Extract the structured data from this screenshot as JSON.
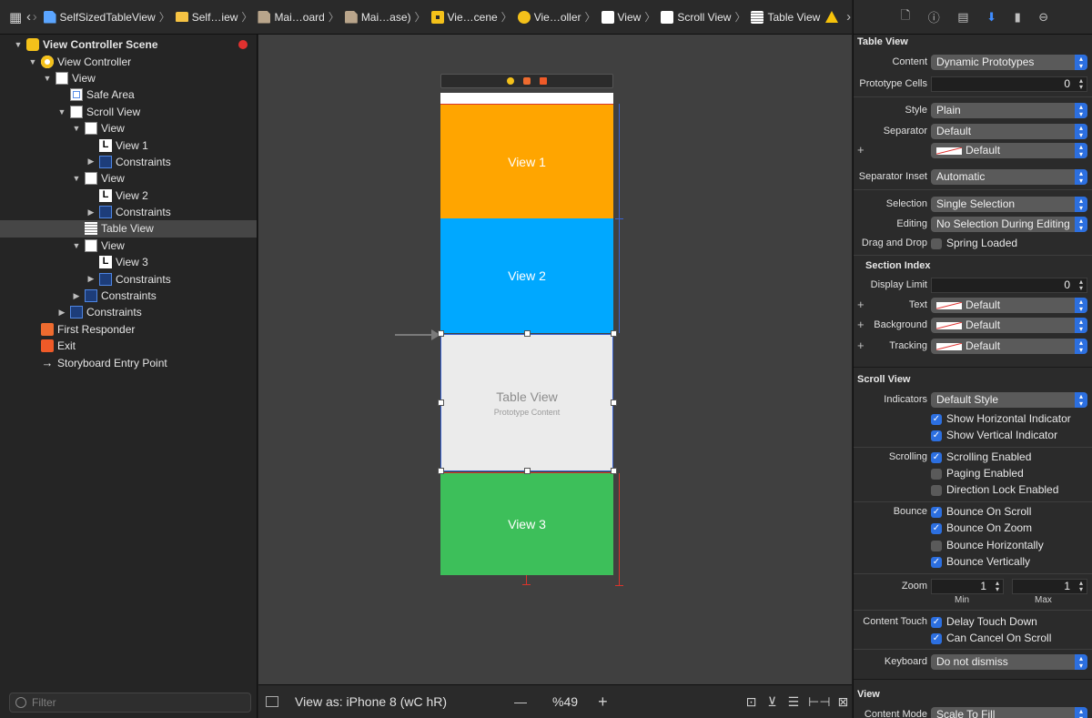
{
  "jumpbar": {
    "crumbs": [
      {
        "label": "SelfSizedTableView",
        "icon": "swift-file-icon"
      },
      {
        "label": "Self…iew",
        "icon": "folder-icon"
      },
      {
        "label": "Mai…oard",
        "icon": "storyboard-icon"
      },
      {
        "label": "Mai…ase)",
        "icon": "storyboard-icon"
      },
      {
        "label": "Vie…cene",
        "icon": "scene-icon"
      },
      {
        "label": "Vie…oller",
        "icon": "view-controller-icon"
      },
      {
        "label": "View",
        "icon": "view-icon"
      },
      {
        "label": "Scroll View",
        "icon": "view-icon"
      },
      {
        "label": "Table View",
        "icon": "table-view-icon"
      }
    ]
  },
  "outline": {
    "scene_title": "View Controller Scene",
    "items": [
      {
        "label": "View Controller",
        "depth": 1,
        "icon": "vc"
      },
      {
        "label": "View",
        "depth": 2,
        "icon": "white"
      },
      {
        "label": "Safe Area",
        "depth": 3,
        "icon": "safe"
      },
      {
        "label": "Scroll View",
        "depth": 3,
        "icon": "white"
      },
      {
        "label": "View",
        "depth": 4,
        "icon": "white"
      },
      {
        "label": "View 1",
        "depth": 5,
        "icon": "label"
      },
      {
        "label": "Constraints",
        "depth": 5,
        "icon": "constr"
      },
      {
        "label": "View",
        "depth": 4,
        "icon": "white"
      },
      {
        "label": "View 2",
        "depth": 5,
        "icon": "label"
      },
      {
        "label": "Constraints",
        "depth": 5,
        "icon": "constr"
      },
      {
        "label": "Table View",
        "depth": 4,
        "icon": "table"
      },
      {
        "label": "View",
        "depth": 4,
        "icon": "white"
      },
      {
        "label": "View 3",
        "depth": 5,
        "icon": "label"
      },
      {
        "label": "Constraints",
        "depth": 5,
        "icon": "constr"
      },
      {
        "label": "Constraints",
        "depth": 4,
        "icon": "constr"
      },
      {
        "label": "Constraints",
        "depth": 3,
        "icon": "constr"
      },
      {
        "label": "First Responder",
        "depth": 1,
        "icon": "resp"
      },
      {
        "label": "Exit",
        "depth": 1,
        "icon": "exit"
      },
      {
        "label": "Storyboard Entry Point",
        "depth": 1,
        "icon": "arrow"
      }
    ],
    "filter_placeholder": "Filter"
  },
  "canvas": {
    "view1_label": "View 1",
    "view2_label": "View 2",
    "table_label": "Table View",
    "table_sub": "Prototype Content",
    "view3_label": "View 3",
    "colors": {
      "view1": "#ffa500",
      "view2": "#00a8ff",
      "view3": "#3dbf5a",
      "table": "#ebebeb"
    }
  },
  "bottombar": {
    "view_as": "View as: iPhone 8 (wC hR)",
    "zoom": "%49"
  },
  "inspector": {
    "table_view_section": "Table View",
    "content_label": "Content",
    "content_value": "Dynamic Prototypes",
    "prototype_cells_label": "Prototype Cells",
    "prototype_cells_value": "0",
    "style_label": "Style",
    "style_value": "Plain",
    "separator_label": "Separator",
    "separator_value": "Default",
    "separator_color_value": "Default",
    "separator_inset_label": "Separator Inset",
    "separator_inset_value": "Automatic",
    "selection_label": "Selection",
    "selection_value": "Single Selection",
    "editing_label": "Editing",
    "editing_value": "No Selection During Editing",
    "drag_drop_label": "Drag and Drop",
    "spring_loaded": "Spring Loaded",
    "section_index_title": "Section Index",
    "display_limit_label": "Display Limit",
    "display_limit_value": "0",
    "text_label": "Text",
    "text_value": "Default",
    "background_label": "Background",
    "background_value": "Default",
    "tracking_label": "Tracking",
    "tracking_value": "Default",
    "scroll_view_section": "Scroll View",
    "indicators_label": "Indicators",
    "indicators_value": "Default Style",
    "show_h": "Show Horizontal Indicator",
    "show_v": "Show Vertical Indicator",
    "scrolling_label": "Scrolling",
    "scrolling_enabled": "Scrolling Enabled",
    "paging_enabled": "Paging Enabled",
    "direction_lock": "Direction Lock Enabled",
    "bounce_label": "Bounce",
    "bounce_on_scroll": "Bounce On Scroll",
    "bounce_on_zoom": "Bounce On Zoom",
    "bounce_h": "Bounce Horizontally",
    "bounce_v": "Bounce Vertically",
    "zoom_label": "Zoom",
    "zoom_min": "1",
    "zoom_max": "1",
    "min_label": "Min",
    "max_label": "Max",
    "content_touch_label": "Content Touch",
    "delay_touch": "Delay Touch Down",
    "cancel_on_scroll": "Can Cancel On Scroll",
    "keyboard_label": "Keyboard",
    "keyboard_value": "Do not dismiss",
    "view_section": "View",
    "content_mode_label": "Content Mode",
    "content_mode_value": "Scale To Fill"
  }
}
